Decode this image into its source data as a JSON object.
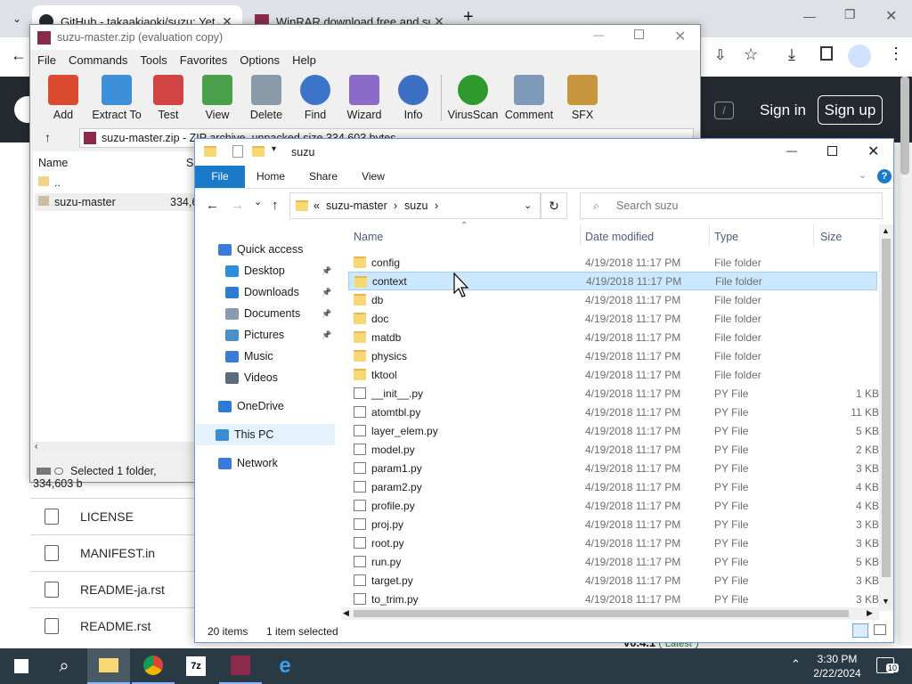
{
  "chrome": {
    "tabs": [
      {
        "label": "GitHub - takaakiaoki/suzu: Yet a",
        "active": true
      },
      {
        "label": "WinRAR download free and sup",
        "active": false
      }
    ]
  },
  "github": {
    "signin": "Sign in",
    "signup": "Sign up",
    "files": [
      "LICENSE",
      "MANIFEST.in",
      "README-ja.rst",
      "README.rst"
    ],
    "release": "v0.4.1",
    "release_badge": "Latest",
    "search_key": "/"
  },
  "winrar": {
    "title": "suzu-master.zip (evaluation copy)",
    "menu": [
      "File",
      "Commands",
      "Tools",
      "Favorites",
      "Options",
      "Help"
    ],
    "tools": [
      {
        "label": "Add",
        "color": "#d94a2f"
      },
      {
        "label": "Extract To",
        "color": "#3c8fd8"
      },
      {
        "label": "Test",
        "color": "#d24444"
      },
      {
        "label": "View",
        "color": "#4aa04a"
      },
      {
        "label": "Delete",
        "color": "#8a9aa8"
      },
      {
        "label": "Find",
        "color": "#3b74c9"
      },
      {
        "label": "Wizard",
        "color": "#8a6bc8"
      },
      {
        "label": "Info",
        "color": "#3d6fc2"
      },
      {
        "label": "VirusScan",
        "color": "#2e9a2e"
      },
      {
        "label": "Comment",
        "color": "#7e9ab8"
      },
      {
        "label": "SFX",
        "color": "#c7953b"
      }
    ],
    "path": "suzu-master.zip - ZIP archive, unpacked size 334,603 bytes",
    "cols": {
      "name": "Name",
      "size": "Si"
    },
    "items": [
      {
        "name": ".."
      },
      {
        "name": "suzu-master",
        "size": "334,6"
      }
    ],
    "status": "Selected 1 folder, 334,603 b"
  },
  "explorer": {
    "title": "suzu",
    "ribbon": [
      "File",
      "Home",
      "Share",
      "View"
    ],
    "breadcrumb": {
      "prefix": "«",
      "parts": [
        "suzu-master",
        "suzu"
      ]
    },
    "search_placeholder": "Search suzu",
    "nav": [
      {
        "label": "Quick access",
        "icon": "star-icon",
        "color": "#3a7bd5",
        "pin": false
      },
      {
        "label": "Desktop",
        "icon": "desktop-icon",
        "color": "#2b8fe0",
        "pin": true
      },
      {
        "label": "Downloads",
        "icon": "download-icon",
        "color": "#2b7cd3",
        "pin": true
      },
      {
        "label": "Documents",
        "icon": "document-icon",
        "color": "#8a9bb0",
        "pin": true
      },
      {
        "label": "Pictures",
        "icon": "picture-icon",
        "color": "#4a90c8",
        "pin": true
      },
      {
        "label": "Music",
        "icon": "music-icon",
        "color": "#3a7bd5",
        "pin": false
      },
      {
        "label": "Videos",
        "icon": "video-icon",
        "color": "#5a6b7b",
        "pin": false
      },
      {
        "label": "OneDrive",
        "icon": "cloud-icon",
        "color": "#2b7cd3",
        "pin": false
      },
      {
        "label": "This PC",
        "icon": "pc-icon",
        "color": "#3a8ad5",
        "pin": false
      },
      {
        "label": "Network",
        "icon": "network-icon",
        "color": "#3a7bd5",
        "pin": false
      }
    ],
    "columns": {
      "name": "Name",
      "date": "Date modified",
      "type": "Type",
      "size": "Size"
    },
    "files": [
      {
        "name": "config",
        "date": "4/19/2018 11:17 PM",
        "type": "File folder",
        "size": "",
        "kind": "folder"
      },
      {
        "name": "context",
        "date": "4/19/2018 11:17 PM",
        "type": "File folder",
        "size": "",
        "kind": "folder",
        "selected": true
      },
      {
        "name": "db",
        "date": "4/19/2018 11:17 PM",
        "type": "File folder",
        "size": "",
        "kind": "folder"
      },
      {
        "name": "doc",
        "date": "4/19/2018 11:17 PM",
        "type": "File folder",
        "size": "",
        "kind": "folder"
      },
      {
        "name": "matdb",
        "date": "4/19/2018 11:17 PM",
        "type": "File folder",
        "size": "",
        "kind": "folder"
      },
      {
        "name": "physics",
        "date": "4/19/2018 11:17 PM",
        "type": "File folder",
        "size": "",
        "kind": "folder"
      },
      {
        "name": "tktool",
        "date": "4/19/2018 11:17 PM",
        "type": "File folder",
        "size": "",
        "kind": "folder"
      },
      {
        "name": "__init__.py",
        "date": "4/19/2018 11:17 PM",
        "type": "PY File",
        "size": "1 KB",
        "kind": "py"
      },
      {
        "name": "atomtbl.py",
        "date": "4/19/2018 11:17 PM",
        "type": "PY File",
        "size": "11 KB",
        "kind": "py"
      },
      {
        "name": "layer_elem.py",
        "date": "4/19/2018 11:17 PM",
        "type": "PY File",
        "size": "5 KB",
        "kind": "py"
      },
      {
        "name": "model.py",
        "date": "4/19/2018 11:17 PM",
        "type": "PY File",
        "size": "2 KB",
        "kind": "py"
      },
      {
        "name": "param1.py",
        "date": "4/19/2018 11:17 PM",
        "type": "PY File",
        "size": "3 KB",
        "kind": "py"
      },
      {
        "name": "param2.py",
        "date": "4/19/2018 11:17 PM",
        "type": "PY File",
        "size": "4 KB",
        "kind": "py"
      },
      {
        "name": "profile.py",
        "date": "4/19/2018 11:17 PM",
        "type": "PY File",
        "size": "4 KB",
        "kind": "py"
      },
      {
        "name": "proj.py",
        "date": "4/19/2018 11:17 PM",
        "type": "PY File",
        "size": "3 KB",
        "kind": "py"
      },
      {
        "name": "root.py",
        "date": "4/19/2018 11:17 PM",
        "type": "PY File",
        "size": "3 KB",
        "kind": "py"
      },
      {
        "name": "run.py",
        "date": "4/19/2018 11:17 PM",
        "type": "PY File",
        "size": "5 KB",
        "kind": "py"
      },
      {
        "name": "target.py",
        "date": "4/19/2018 11:17 PM",
        "type": "PY File",
        "size": "3 KB",
        "kind": "py"
      },
      {
        "name": "to_trim.py",
        "date": "4/19/2018 11:17 PM",
        "type": "PY File",
        "size": "3 KB",
        "kind": "py"
      }
    ],
    "status_count": "20 items",
    "status_sel": "1 item selected"
  },
  "taskbar": {
    "time": "3:30 PM",
    "date": "2/22/2024",
    "notif_count": "10"
  }
}
